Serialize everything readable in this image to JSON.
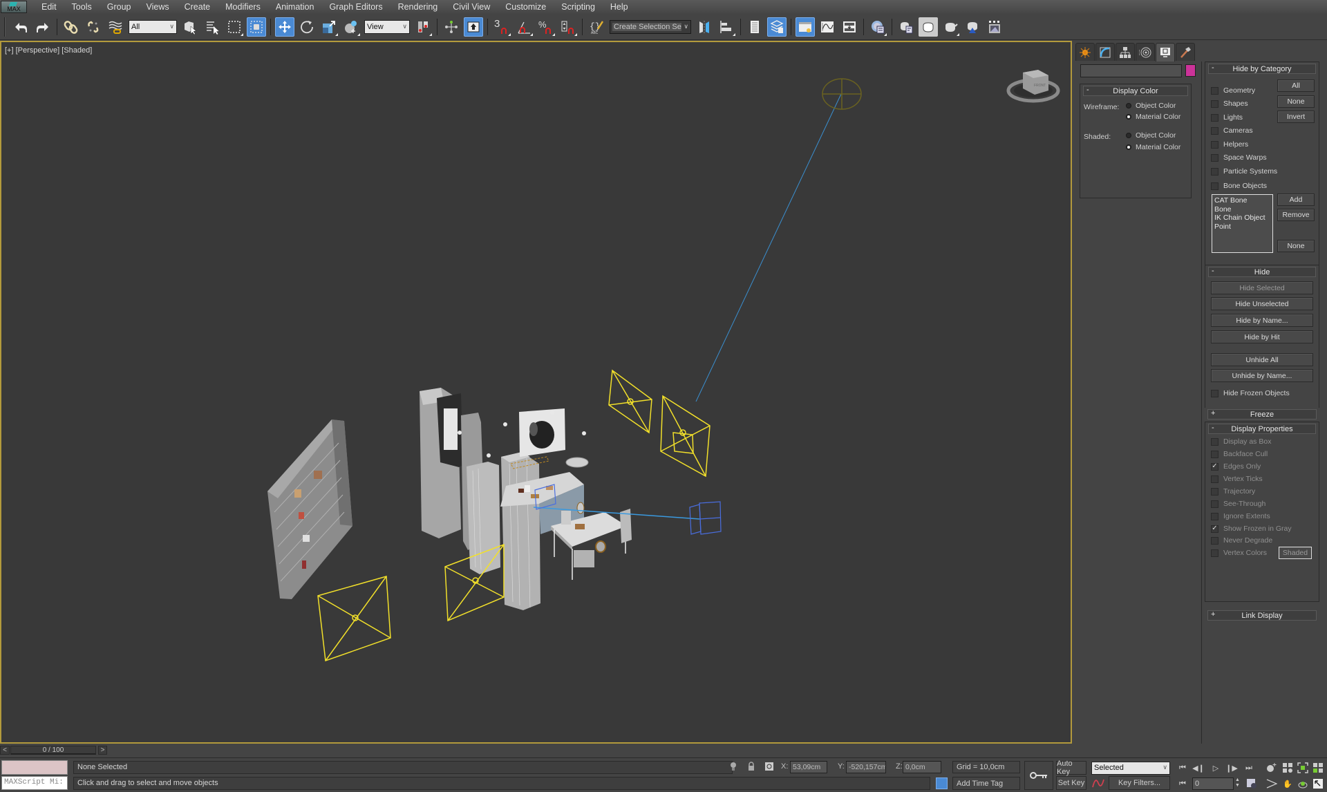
{
  "app": {
    "logo_label": "MAX"
  },
  "menu": [
    "Edit",
    "Tools",
    "Group",
    "Views",
    "Create",
    "Modifiers",
    "Animation",
    "Graph Editors",
    "Rendering",
    "Civil View",
    "Customize",
    "Scripting",
    "Help"
  ],
  "toolbar": {
    "selection_filter": "All",
    "ref_coord_system": "View",
    "named_selection_placeholder": "Create Selection Se",
    "snap_label": "3",
    "percent_snap_label": "%"
  },
  "viewport": {
    "label_plus": "[+]",
    "label_view": "[Perspective]",
    "label_shading": "[Shaded]",
    "viewcube_face": "FRONT",
    "colors": {
      "border_active": "#b39a3c",
      "light_gizmo": "#f2e02a",
      "camera_gizmo": "#4a6ee0",
      "target_line": "#3a8fd0"
    }
  },
  "command_panel": {
    "tabs": [
      "create",
      "modify",
      "hierarchy",
      "motion",
      "display",
      "utilities"
    ],
    "active_tab": "display",
    "object_name": "",
    "object_color": "#cc3399",
    "display_color": {
      "title": "Display Color",
      "collapse_sign": "-",
      "wireframe_label": "Wireframe:",
      "shaded_label": "Shaded:",
      "wireframe_options": [
        {
          "label": "Object Color",
          "selected": false
        },
        {
          "label": "Material Color",
          "selected": true
        }
      ],
      "shaded_options": [
        {
          "label": "Object Color",
          "selected": false
        },
        {
          "label": "Material Color",
          "selected": true
        }
      ]
    },
    "hide_by_category": {
      "title": "Hide by Category",
      "collapse_sign": "-",
      "categories": [
        {
          "label": "Geometry",
          "checked": false
        },
        {
          "label": "Shapes",
          "checked": false
        },
        {
          "label": "Lights",
          "checked": false
        },
        {
          "label": "Cameras",
          "checked": false
        },
        {
          "label": "Helpers",
          "checked": false
        },
        {
          "label": "Space Warps",
          "checked": false
        },
        {
          "label": "Particle Systems",
          "checked": false
        },
        {
          "label": "Bone Objects",
          "checked": false
        }
      ],
      "buttons": {
        "all": "All",
        "none": "None",
        "invert": "Invert"
      },
      "list_items": [
        "CAT Bone",
        "Bone",
        "IK Chain Object",
        "Point"
      ],
      "list_buttons": {
        "add": "Add",
        "remove": "Remove",
        "none": "None"
      }
    },
    "hide": {
      "title": "Hide",
      "collapse_sign": "-",
      "buttons": [
        "Hide Selected",
        "Hide Unselected",
        "Hide by Name...",
        "Hide by Hit"
      ],
      "buttons2": [
        "Unhide All",
        "Unhide by Name..."
      ],
      "hide_frozen": {
        "label": "Hide Frozen Objects",
        "checked": false
      }
    },
    "freeze": {
      "title": "Freeze",
      "collapse_sign": "+"
    },
    "display_properties": {
      "title": "Display Properties",
      "collapse_sign": "-",
      "options": [
        {
          "label": "Display as Box",
          "checked": false
        },
        {
          "label": "Backface Cull",
          "checked": false
        },
        {
          "label": "Edges Only",
          "checked": true
        },
        {
          "label": "Vertex Ticks",
          "checked": false
        },
        {
          "label": "Trajectory",
          "checked": false
        },
        {
          "label": "See-Through",
          "checked": false
        },
        {
          "label": "Ignore Extents",
          "checked": false
        },
        {
          "label": "Show Frozen in Gray",
          "checked": true
        },
        {
          "label": "Never Degrade",
          "checked": false
        },
        {
          "label": "Vertex Colors",
          "checked": false
        }
      ],
      "shaded_button": "Shaded"
    },
    "link_display": {
      "title": "Link Display",
      "collapse_sign": "+"
    }
  },
  "timeline": {
    "prev": "<",
    "next": ">",
    "frame_display": "0 / 100",
    "current_frame": 0,
    "total_frames": 100
  },
  "status": {
    "maxscript_placeholder": "MAXScript Mi:",
    "selection": "None Selected",
    "prompt": "Click and drag to select and move objects",
    "x_label": "X:",
    "y_label": "Y:",
    "z_label": "Z:",
    "x_value": "53,09cm",
    "y_value": "-520,157cm",
    "z_value": "0,0cm",
    "grid": "Grid = 10,0cm",
    "add_time_tag": "Add Time Tag",
    "auto_key": "Auto Key",
    "set_key": "Set Key",
    "key_mode": "Selected",
    "key_filters": "Key Filters...",
    "frame_value": "0"
  }
}
